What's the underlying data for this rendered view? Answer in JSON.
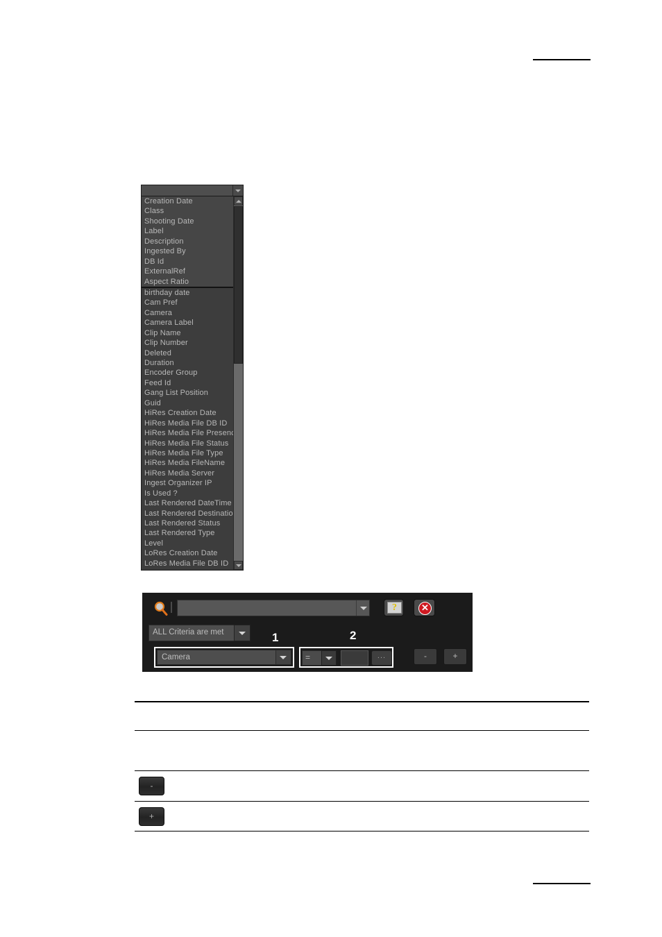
{
  "page": {
    "background_color": "#ffffff",
    "rule_color": "#000000"
  },
  "field_list": {
    "combo_value": "",
    "top_combo_icon": "chevron-down-icon",
    "group_primary": [
      "Creation Date",
      "Class",
      "Shooting Date",
      "Label",
      "Description",
      "Ingested By",
      "DB Id",
      "ExternalRef",
      "Aspect Ratio"
    ],
    "group_secondary": [
      "birthday date",
      "Cam Pref",
      "Camera",
      "Camera Label",
      "Clip Name",
      "Clip Number",
      "Deleted",
      "Duration",
      "Encoder Group",
      "Feed Id",
      "Gang List Position",
      "Guid",
      "HiRes Creation Date",
      "HiRes Media File DB ID",
      "HiRes Media File Presence",
      "HiRes Media File Status",
      "HiRes Media File Type",
      "HiRes Media FileName",
      "HiRes Media Server",
      "Ingest Organizer IP",
      "Is Used ?",
      "Last Rendered DateTime",
      "Last Rendered Destination",
      "Last Rendered Status",
      "Last Rendered Type",
      "Level",
      "LoRes Creation Date",
      "LoRes Media File DB ID"
    ],
    "scrollbar": {
      "up_icon": "chevron-up-icon",
      "down_icon": "chevron-down-icon"
    }
  },
  "search_toolbar": {
    "magnifier_icon": "search-icon",
    "search_value": "",
    "search_placeholder": "",
    "search_dropdown_icon": "chevron-down-icon",
    "help_button": {
      "icon": "question-mark-icon",
      "glyph": "?"
    },
    "close_button": {
      "icon": "close-icon",
      "glyph": "✕",
      "color": "#cf1a22"
    },
    "criteria_mode": {
      "selected": "ALL Criteria are met",
      "dropdown_icon": "chevron-down-icon"
    },
    "field_select": {
      "selected": "Camera",
      "dropdown_icon": "chevron-down-icon"
    },
    "operator": {
      "selected": "=",
      "dropdown_icon": "chevron-down-icon"
    },
    "value": {
      "text": "",
      "placeholder": ""
    },
    "browse_button_label": "...",
    "remove_button_label": "-",
    "add_button_label": "+",
    "callouts": {
      "one": "1",
      "two": "2"
    }
  },
  "description_table": {
    "rows": [
      {
        "icon": "",
        "text": ""
      },
      {
        "icon": "",
        "text": ""
      },
      {
        "icon": "minus-button",
        "label": "-",
        "text": ""
      },
      {
        "icon": "plus-button",
        "label": "+",
        "text": ""
      }
    ]
  }
}
